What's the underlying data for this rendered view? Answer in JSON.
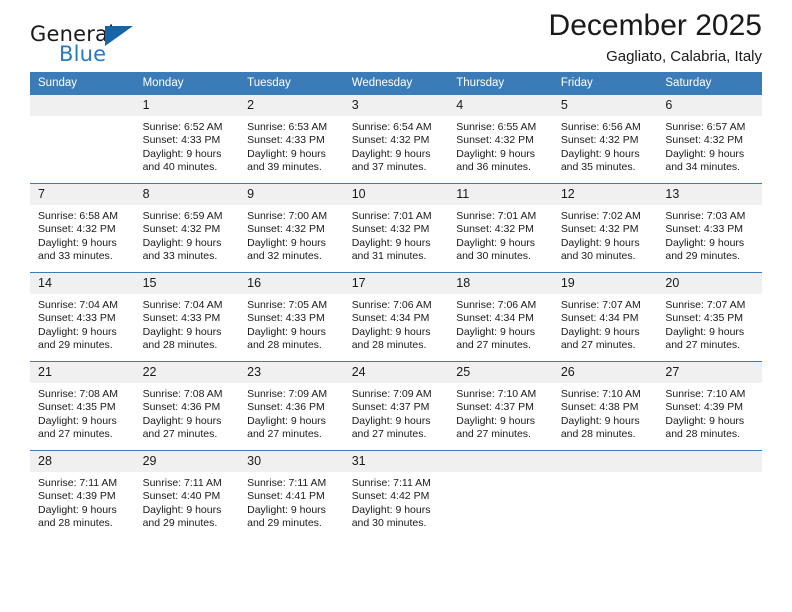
{
  "brand": {
    "word1": "General",
    "word2": "Blue",
    "logo_icon": "triangle-logo-icon",
    "accent_color": "#2a7ac0"
  },
  "header": {
    "month_title": "December 2025",
    "location": "Gagliato, Calabria, Italy"
  },
  "calendar": {
    "header_color": "#3b7cb8",
    "daynum_band_color": "#f0f0f0",
    "weekdays": [
      "Sunday",
      "Monday",
      "Tuesday",
      "Wednesday",
      "Thursday",
      "Friday",
      "Saturday"
    ],
    "weeks": [
      [
        {
          "day": "",
          "sunrise": "",
          "sunset": "",
          "daylight1": "",
          "daylight2": ""
        },
        {
          "day": "1",
          "sunrise": "Sunrise: 6:52 AM",
          "sunset": "Sunset: 4:33 PM",
          "daylight1": "Daylight: 9 hours",
          "daylight2": "and 40 minutes."
        },
        {
          "day": "2",
          "sunrise": "Sunrise: 6:53 AM",
          "sunset": "Sunset: 4:33 PM",
          "daylight1": "Daylight: 9 hours",
          "daylight2": "and 39 minutes."
        },
        {
          "day": "3",
          "sunrise": "Sunrise: 6:54 AM",
          "sunset": "Sunset: 4:32 PM",
          "daylight1": "Daylight: 9 hours",
          "daylight2": "and 37 minutes."
        },
        {
          "day": "4",
          "sunrise": "Sunrise: 6:55 AM",
          "sunset": "Sunset: 4:32 PM",
          "daylight1": "Daylight: 9 hours",
          "daylight2": "and 36 minutes."
        },
        {
          "day": "5",
          "sunrise": "Sunrise: 6:56 AM",
          "sunset": "Sunset: 4:32 PM",
          "daylight1": "Daylight: 9 hours",
          "daylight2": "and 35 minutes."
        },
        {
          "day": "6",
          "sunrise": "Sunrise: 6:57 AM",
          "sunset": "Sunset: 4:32 PM",
          "daylight1": "Daylight: 9 hours",
          "daylight2": "and 34 minutes."
        }
      ],
      [
        {
          "day": "7",
          "sunrise": "Sunrise: 6:58 AM",
          "sunset": "Sunset: 4:32 PM",
          "daylight1": "Daylight: 9 hours",
          "daylight2": "and 33 minutes."
        },
        {
          "day": "8",
          "sunrise": "Sunrise: 6:59 AM",
          "sunset": "Sunset: 4:32 PM",
          "daylight1": "Daylight: 9 hours",
          "daylight2": "and 33 minutes."
        },
        {
          "day": "9",
          "sunrise": "Sunrise: 7:00 AM",
          "sunset": "Sunset: 4:32 PM",
          "daylight1": "Daylight: 9 hours",
          "daylight2": "and 32 minutes."
        },
        {
          "day": "10",
          "sunrise": "Sunrise: 7:01 AM",
          "sunset": "Sunset: 4:32 PM",
          "daylight1": "Daylight: 9 hours",
          "daylight2": "and 31 minutes."
        },
        {
          "day": "11",
          "sunrise": "Sunrise: 7:01 AM",
          "sunset": "Sunset: 4:32 PM",
          "daylight1": "Daylight: 9 hours",
          "daylight2": "and 30 minutes."
        },
        {
          "day": "12",
          "sunrise": "Sunrise: 7:02 AM",
          "sunset": "Sunset: 4:32 PM",
          "daylight1": "Daylight: 9 hours",
          "daylight2": "and 30 minutes."
        },
        {
          "day": "13",
          "sunrise": "Sunrise: 7:03 AM",
          "sunset": "Sunset: 4:33 PM",
          "daylight1": "Daylight: 9 hours",
          "daylight2": "and 29 minutes."
        }
      ],
      [
        {
          "day": "14",
          "sunrise": "Sunrise: 7:04 AM",
          "sunset": "Sunset: 4:33 PM",
          "daylight1": "Daylight: 9 hours",
          "daylight2": "and 29 minutes."
        },
        {
          "day": "15",
          "sunrise": "Sunrise: 7:04 AM",
          "sunset": "Sunset: 4:33 PM",
          "daylight1": "Daylight: 9 hours",
          "daylight2": "and 28 minutes."
        },
        {
          "day": "16",
          "sunrise": "Sunrise: 7:05 AM",
          "sunset": "Sunset: 4:33 PM",
          "daylight1": "Daylight: 9 hours",
          "daylight2": "and 28 minutes."
        },
        {
          "day": "17",
          "sunrise": "Sunrise: 7:06 AM",
          "sunset": "Sunset: 4:34 PM",
          "daylight1": "Daylight: 9 hours",
          "daylight2": "and 28 minutes."
        },
        {
          "day": "18",
          "sunrise": "Sunrise: 7:06 AM",
          "sunset": "Sunset: 4:34 PM",
          "daylight1": "Daylight: 9 hours",
          "daylight2": "and 27 minutes."
        },
        {
          "day": "19",
          "sunrise": "Sunrise: 7:07 AM",
          "sunset": "Sunset: 4:34 PM",
          "daylight1": "Daylight: 9 hours",
          "daylight2": "and 27 minutes."
        },
        {
          "day": "20",
          "sunrise": "Sunrise: 7:07 AM",
          "sunset": "Sunset: 4:35 PM",
          "daylight1": "Daylight: 9 hours",
          "daylight2": "and 27 minutes."
        }
      ],
      [
        {
          "day": "21",
          "sunrise": "Sunrise: 7:08 AM",
          "sunset": "Sunset: 4:35 PM",
          "daylight1": "Daylight: 9 hours",
          "daylight2": "and 27 minutes."
        },
        {
          "day": "22",
          "sunrise": "Sunrise: 7:08 AM",
          "sunset": "Sunset: 4:36 PM",
          "daylight1": "Daylight: 9 hours",
          "daylight2": "and 27 minutes."
        },
        {
          "day": "23",
          "sunrise": "Sunrise: 7:09 AM",
          "sunset": "Sunset: 4:36 PM",
          "daylight1": "Daylight: 9 hours",
          "daylight2": "and 27 minutes."
        },
        {
          "day": "24",
          "sunrise": "Sunrise: 7:09 AM",
          "sunset": "Sunset: 4:37 PM",
          "daylight1": "Daylight: 9 hours",
          "daylight2": "and 27 minutes."
        },
        {
          "day": "25",
          "sunrise": "Sunrise: 7:10 AM",
          "sunset": "Sunset: 4:37 PM",
          "daylight1": "Daylight: 9 hours",
          "daylight2": "and 27 minutes."
        },
        {
          "day": "26",
          "sunrise": "Sunrise: 7:10 AM",
          "sunset": "Sunset: 4:38 PM",
          "daylight1": "Daylight: 9 hours",
          "daylight2": "and 28 minutes."
        },
        {
          "day": "27",
          "sunrise": "Sunrise: 7:10 AM",
          "sunset": "Sunset: 4:39 PM",
          "daylight1": "Daylight: 9 hours",
          "daylight2": "and 28 minutes."
        }
      ],
      [
        {
          "day": "28",
          "sunrise": "Sunrise: 7:11 AM",
          "sunset": "Sunset: 4:39 PM",
          "daylight1": "Daylight: 9 hours",
          "daylight2": "and 28 minutes."
        },
        {
          "day": "29",
          "sunrise": "Sunrise: 7:11 AM",
          "sunset": "Sunset: 4:40 PM",
          "daylight1": "Daylight: 9 hours",
          "daylight2": "and 29 minutes."
        },
        {
          "day": "30",
          "sunrise": "Sunrise: 7:11 AM",
          "sunset": "Sunset: 4:41 PM",
          "daylight1": "Daylight: 9 hours",
          "daylight2": "and 29 minutes."
        },
        {
          "day": "31",
          "sunrise": "Sunrise: 7:11 AM",
          "sunset": "Sunset: 4:42 PM",
          "daylight1": "Daylight: 9 hours",
          "daylight2": "and 30 minutes."
        },
        {
          "day": "",
          "sunrise": "",
          "sunset": "",
          "daylight1": "",
          "daylight2": ""
        },
        {
          "day": "",
          "sunrise": "",
          "sunset": "",
          "daylight1": "",
          "daylight2": ""
        },
        {
          "day": "",
          "sunrise": "",
          "sunset": "",
          "daylight1": "",
          "daylight2": ""
        }
      ]
    ]
  }
}
